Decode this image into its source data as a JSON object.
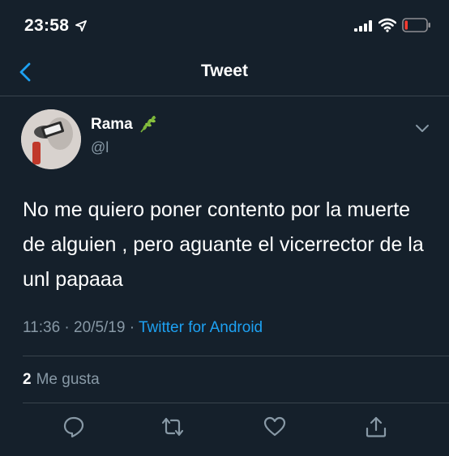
{
  "status_bar": {
    "time": "23:58",
    "icons": [
      "location-arrow-icon",
      "signal-icon",
      "wifi-icon",
      "battery-low-icon"
    ]
  },
  "nav": {
    "title": "Tweet",
    "back_icon": "chevron-left-icon"
  },
  "author": {
    "name": "Rama",
    "handle": "@l",
    "badge_icon": "leaf-icon"
  },
  "tweet": {
    "text": "No me quiero poner contento por la muerte de alguien , pero aguante el vicerrector de la unl papaaa",
    "time": "11:36",
    "separator1": " · ",
    "date": "20/5/19",
    "separator2": " · ",
    "source": "Twitter for Android"
  },
  "stats": {
    "likes_count": "2",
    "likes_label": "Me gusta"
  },
  "actions": [
    "reply-icon",
    "retweet-icon",
    "like-icon",
    "share-icon"
  ],
  "colors": {
    "background": "#15202b",
    "accent": "#1da1f2",
    "muted": "#8899a6",
    "divider": "#38444d"
  }
}
